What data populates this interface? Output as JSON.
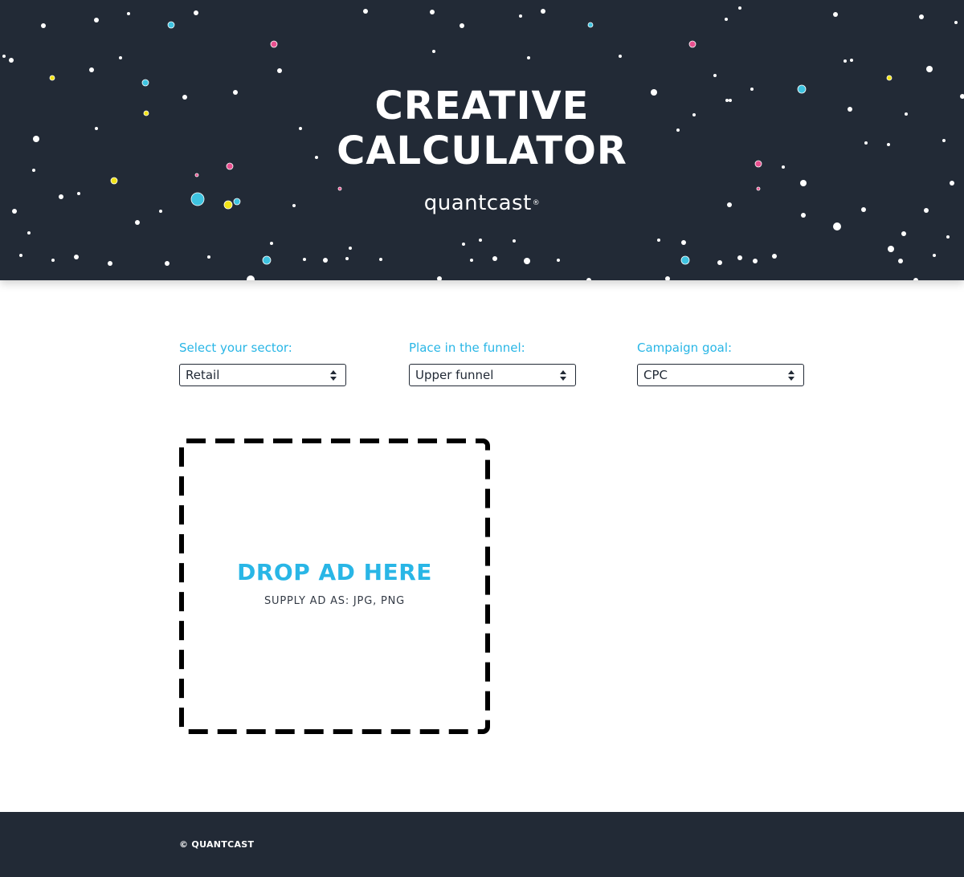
{
  "header": {
    "title_line1": "CREATIVE",
    "title_line2": "CALCULATOR",
    "brand": "quantcast",
    "brand_mark": "®"
  },
  "form": {
    "sector": {
      "label": "Select your sector:",
      "value": "Retail"
    },
    "funnel": {
      "label": "Place in the funnel:",
      "value": "Upper funnel"
    },
    "goal": {
      "label": "Campaign goal:",
      "value": "CPC"
    }
  },
  "dropzone": {
    "title": "DROP AD HERE",
    "subtitle": "SUPPLY AD AS: JPG, PNG"
  },
  "footer": {
    "copyright": "© QUANTCAST"
  },
  "colors": {
    "hero_bg": "#222a36",
    "accent": "#29b6e6",
    "dot_pink": "#e8508f",
    "dot_yellow": "#f2e317",
    "dot_cyan": "#3ec3e0"
  }
}
